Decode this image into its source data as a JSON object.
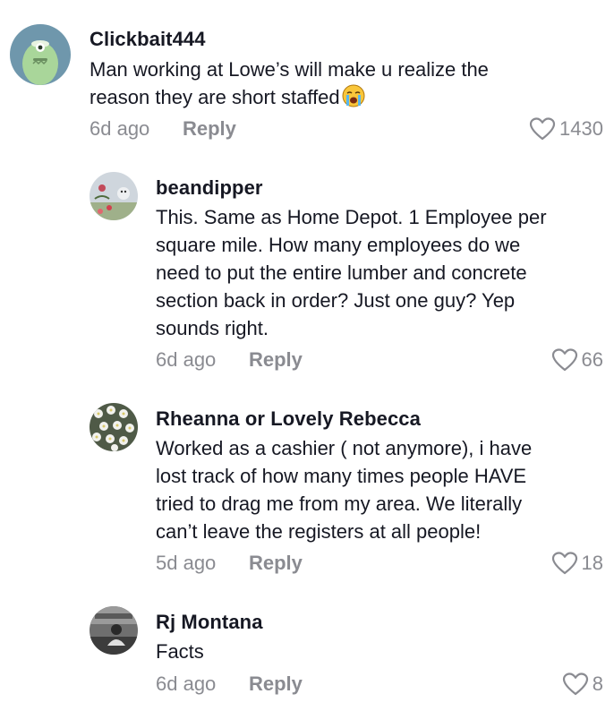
{
  "comments": [
    {
      "username": "Clickbait444",
      "text": "Man working at Lowe’s will make u realize the\nreason they are short staffed",
      "emoji": "loudly-crying-face",
      "time": "6d ago",
      "reply_label": "Reply",
      "likes": "1430"
    },
    {
      "username": "beandipper",
      "text": "This. Same as Home Depot. 1 Employee per\nsquare mile. How many employees do we\nneed to put the entire lumber and concrete\nsection back in order? Just one guy? Yep\nsounds right.",
      "time": "6d ago",
      "reply_label": "Reply",
      "likes": "66"
    },
    {
      "username": "Rheanna or Lovely Rebecca",
      "text": "Worked as a cashier ( not anymore), i have\nlost track of how many times people HAVE\ntried to drag me from my area. We literally\ncan’t leave the registers at all people!",
      "time": "5d ago",
      "reply_label": "Reply",
      "likes": "18"
    },
    {
      "username": "Rj Montana",
      "text": "Facts",
      "time": "6d ago",
      "reply_label": "Reply",
      "likes": "8"
    }
  ],
  "colors": {
    "text": "#161823",
    "secondary": "#8a8b91",
    "background": "#ffffff"
  },
  "icons": {
    "like": "heart-outline-icon"
  }
}
